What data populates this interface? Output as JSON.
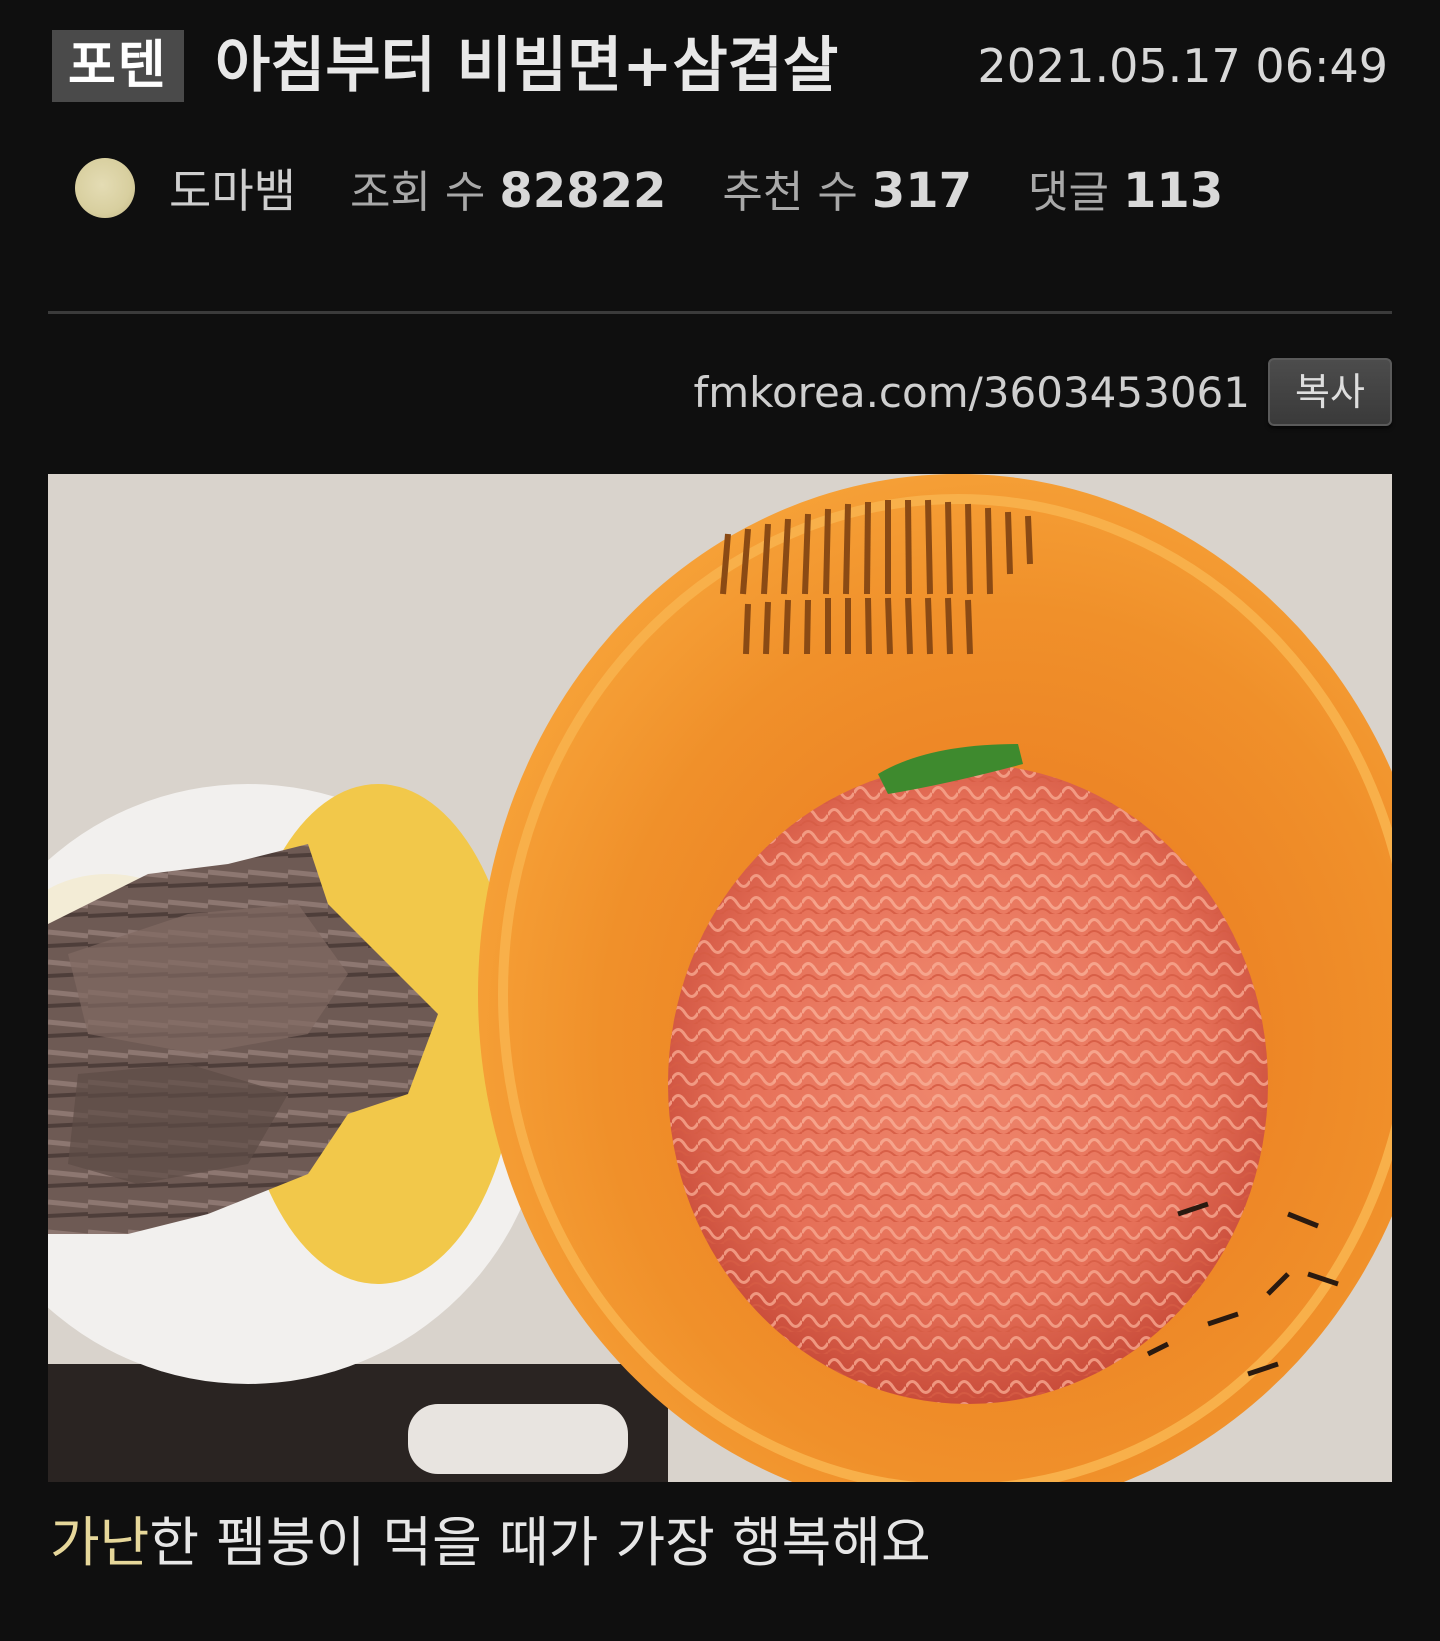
{
  "post": {
    "category": "포텐",
    "title": "아침부터 비빔면+삼겹살",
    "date": "2021.05.17 06:49",
    "author": "도마뱀",
    "stats": {
      "views_label": "조회 수",
      "views_value": "82822",
      "likes_label": "추천 수",
      "likes_value": "317",
      "comments_label": "댓글",
      "comments_value": "113"
    },
    "short_url": "fmkorea.com/3603453061",
    "copy_label": "복사",
    "caption_highlight": "가난",
    "caption_rest": "한 펨붕이 먹을 때가 가장 행복해요"
  },
  "colors": {
    "background": "#0f0f0f",
    "badge": "#4a4a4a",
    "highlight": "#e6d79a"
  }
}
